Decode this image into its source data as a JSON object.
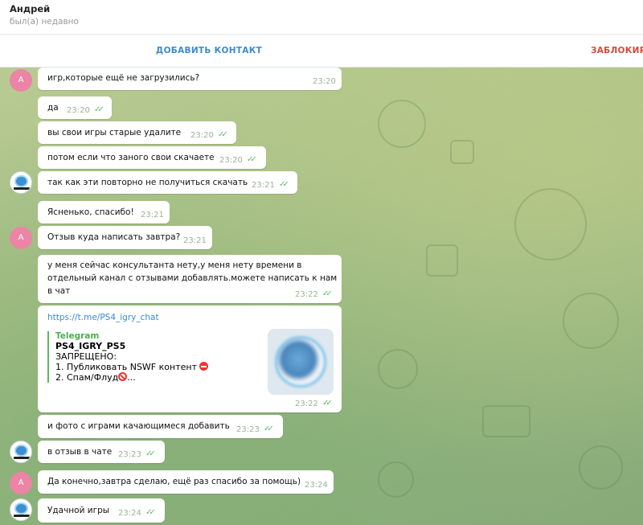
{
  "header": {
    "name": "Андрей",
    "status": "был(а) недавно"
  },
  "actions": {
    "add_contact": "ДОБАВИТЬ КОНТАКТ",
    "block": "ЗАБЛОКИРО"
  },
  "messages": [
    {
      "text": "игр,которые ещё не загрузились?",
      "time": "23:20",
      "read": false,
      "avatar": "A"
    },
    {
      "text": "да",
      "time": "23:20",
      "read": true
    },
    {
      "text": "вы свои игры старые удалите",
      "time": "23:20",
      "read": true
    },
    {
      "text": "потом если что заного свои скачаете",
      "time": "23:20",
      "read": true
    },
    {
      "text": "так как эти повторно не получиться скачать",
      "time": "23:21",
      "read": true
    },
    {
      "text": "Ясненько, спасибо!",
      "time": "23:21",
      "read": false
    },
    {
      "text": "Отзыв куда написать завтра?",
      "time": "23:21",
      "read": false,
      "avatar": "A"
    },
    {
      "text_lines": [
        "у меня сейчас консультанта нету,у меня нету времени в",
        "отдельный канал с отзывами добавлять.можете написать к нам",
        "в чат"
      ],
      "time": "23:22",
      "read": true
    },
    {
      "link": "https://t.me/PS4_igry_chat",
      "preview": {
        "site": "Telegram",
        "title": "PS4_IGRY_PS5",
        "line1": "ЗАПРЕЩЕНО:",
        "line2": "1. Публиковать NSWF контент",
        "line3": "2. Спам/Флуд",
        "ellipsis": "..."
      },
      "time": "23:22",
      "read": true
    },
    {
      "text": "и фото с играми качающимеся добавить",
      "time": "23:23",
      "read": true
    },
    {
      "text": "в отзыв в чате",
      "time": "23:23",
      "read": true
    },
    {
      "text": "Да конечно,завтра сделаю, ещё раз спасибо за помощь)",
      "time": "23:24",
      "read": false,
      "avatar": "A"
    },
    {
      "text": "Удачной игры",
      "time": "23:24",
      "read": true
    }
  ],
  "avatar_letter": "А",
  "colors": {
    "accent": "#3a8bd0",
    "danger": "#d04a3a",
    "check": "#5cba66",
    "avatar": "#ec84a6"
  },
  "icons": [
    "double-check-icon",
    "stop-sign-icon",
    "no-entry-icon",
    "channel-logo-icon"
  ]
}
